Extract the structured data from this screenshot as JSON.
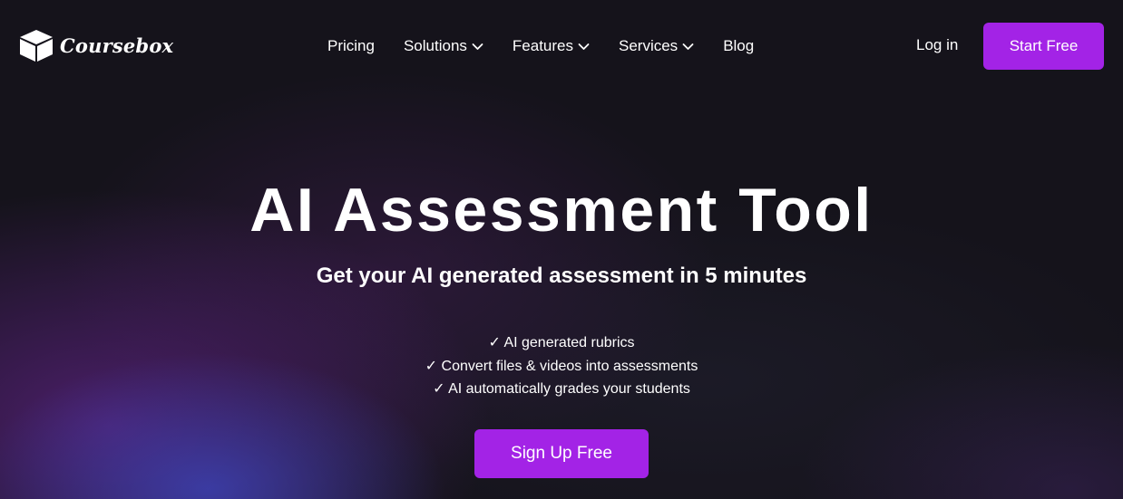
{
  "brand": {
    "name": "Coursebox",
    "logo_icon": "box-icon"
  },
  "nav": {
    "items": [
      {
        "label": "Pricing",
        "has_dropdown": false
      },
      {
        "label": "Solutions",
        "has_dropdown": true
      },
      {
        "label": "Features",
        "has_dropdown": true
      },
      {
        "label": "Services",
        "has_dropdown": true
      },
      {
        "label": "Blog",
        "has_dropdown": false
      }
    ],
    "login_label": "Log in",
    "cta_label": "Start Free"
  },
  "hero": {
    "title": "AI Assessment Tool",
    "subtitle": "Get your AI generated assessment in 5 minutes",
    "features": [
      "✓ AI generated rubrics",
      "✓ Convert files & videos into assessments",
      "✓ AI automatically grades your students"
    ],
    "cta_label": "Sign Up Free"
  },
  "colors": {
    "background": "#15131b",
    "accent": "#a323e6",
    "text": "#ffffff"
  }
}
